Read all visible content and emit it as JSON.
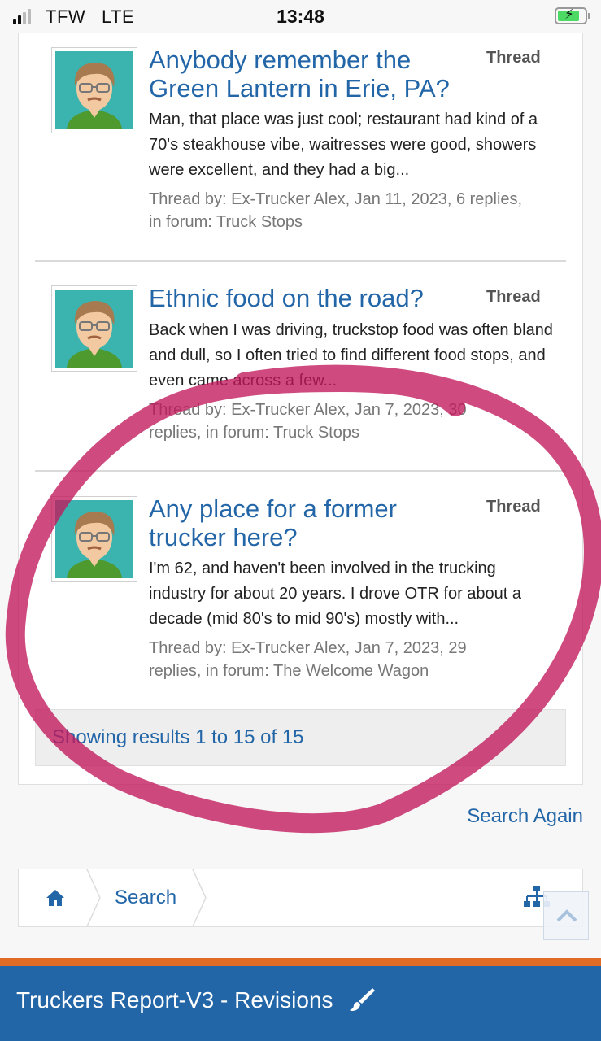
{
  "status_bar": {
    "carrier": "TFW",
    "network": "LTE",
    "time": "13:48",
    "signal_bars": 2,
    "signal_bars_total": 4,
    "battery_charging": true
  },
  "results": [
    {
      "title": "Anybody remember the Green Lantern in Erie, PA?",
      "type": "Thread",
      "snippet": "Man, that place was just cool; restaurant had kind of a 70's steakhouse vibe, waitresses were good, showers were excellent, and they had a big...",
      "meta": "Thread by: Ex-Trucker Alex, Jan 11, 2023, 6 replies, in forum: Truck Stops"
    },
    {
      "title": "Ethnic food on the road?",
      "type": "Thread",
      "snippet": "Back when I was driving, truckstop food was often bland and dull, so I often tried to find different food stops, and even came across a few...",
      "meta": "Thread by: Ex-Trucker Alex, Jan 7, 2023, 30 replies, in forum: Truck Stops"
    },
    {
      "title": "Any place for a former trucker here?",
      "type": "Thread",
      "snippet": "I'm 62, and haven't been involved in the trucking industry for about 20 years. I drove OTR for about a decade (mid 80's to mid 90's) mostly with...",
      "meta": "Thread by: Ex-Trucker Alex, Jan 7, 2023, 29 replies, in forum: The Welcome Wagon"
    }
  ],
  "results_footer": "Showing results 1 to 15 of 15",
  "search_again": "Search Again",
  "breadcrumb": {
    "home_icon": "home-icon",
    "search": "Search",
    "sitemap_icon": "sitemap-icon"
  },
  "scroll_top_icon": "chevron-up-icon",
  "footer": {
    "title": "Truckers Report-V3 - Revisions",
    "icon": "paintbrush-icon"
  },
  "colors": {
    "link": "#2366a8",
    "footer_bg": "#2366a8",
    "footer_strip": "#e06b25",
    "annotation": "#c2185b",
    "avatar_bg": "#3bb3ae"
  }
}
